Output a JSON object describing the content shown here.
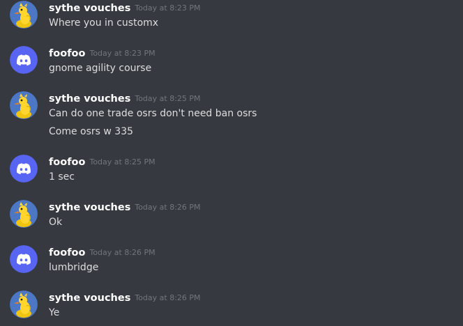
{
  "colors": {
    "background": "#36393f",
    "discord_blurple": "#5865f2",
    "username": "#ffffff",
    "message_text": "#dcddde",
    "timestamp": "#72767d"
  },
  "messages": [
    {
      "author": "sythe vouches",
      "avatar": "duck-avatar-icon",
      "time": "Today at 8:23 PM",
      "lines": [
        "Where you in customx"
      ]
    },
    {
      "author": "foofoo",
      "avatar": "discord-default-avatar-icon",
      "time": "Today at 8:23 PM",
      "lines": [
        "gnome agility course"
      ]
    },
    {
      "author": "sythe vouches",
      "avatar": "duck-avatar-icon",
      "time": "Today at 8:25 PM",
      "lines": [
        "Can do one trade osrs don't need ban osrs",
        "Come osrs w 335"
      ]
    },
    {
      "author": "foofoo",
      "avatar": "discord-default-avatar-icon",
      "time": "Today at 8:25 PM",
      "lines": [
        "1 sec"
      ]
    },
    {
      "author": "sythe vouches",
      "avatar": "duck-avatar-icon",
      "time": "Today at 8:26 PM",
      "lines": [
        "Ok"
      ]
    },
    {
      "author": "foofoo",
      "avatar": "discord-default-avatar-icon",
      "time": "Today at 8:26 PM",
      "lines": [
        "lumbridge"
      ]
    },
    {
      "author": "sythe vouches",
      "avatar": "duck-avatar-icon",
      "time": "Today at 8:26 PM",
      "lines": [
        "Ye"
      ]
    }
  ]
}
